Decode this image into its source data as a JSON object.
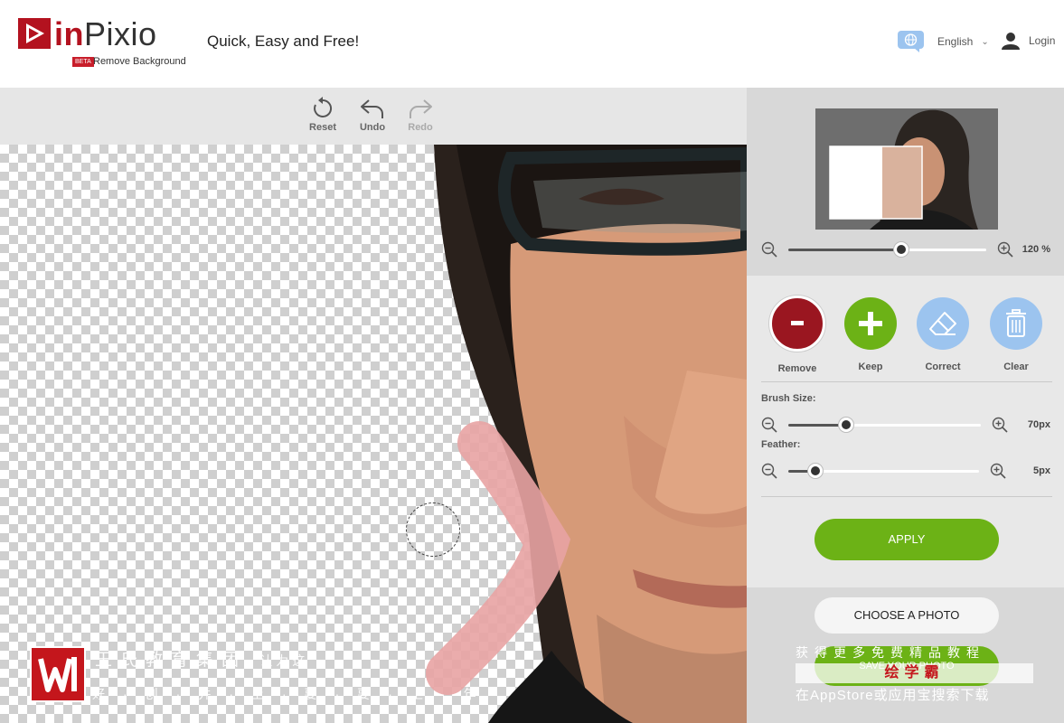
{
  "header": {
    "logo_text_1": "in",
    "logo_text_2": "Pixio",
    "logo_badge": "BETA",
    "logo_subtitle": "Remove Background",
    "tagline": "Quick, Easy and Free!",
    "language": "English",
    "login": "Login"
  },
  "toolbar": {
    "reset": "Reset",
    "undo": "Undo",
    "redo": "Redo"
  },
  "panel": {
    "zoom": {
      "value_label": "120 %",
      "level": 0.57
    },
    "tools": [
      {
        "label": "Remove",
        "icon": "minus-icon",
        "color": "#9a1620"
      },
      {
        "label": "Keep",
        "icon": "plus-icon",
        "color": "#6cb216"
      },
      {
        "label": "Correct",
        "icon": "eraser-icon",
        "color": "#9cc4ef"
      },
      {
        "label": "Clear",
        "icon": "trash-icon",
        "color": "#9cc4ef"
      }
    ],
    "brush_size": {
      "label": "Brush Size:",
      "value_label": "70px",
      "level": 0.3
    },
    "feather": {
      "label": "Feather:",
      "value_label": "5px",
      "level": 0.14
    },
    "apply": "APPLY",
    "choose_photo": "CHOOSE A PHOTO",
    "save_photo": "SAVE YOUR PHOTO"
  },
  "watermark": {
    "left_line1": "王氏教育集团",
    "left_line1b": "认为这",
    "left_line2": "好·创·并·上·要·要·上·年",
    "right_line1": "获得更多免费精品教程",
    "right_line2": "绘学霸",
    "right_line3": "在AppStore或应用宝搜索下载"
  },
  "colors": {
    "accent_green": "#6cb216",
    "remove_red": "#9a1620",
    "light_blue": "#9cc4ef",
    "brand_red": "#b3121f"
  }
}
